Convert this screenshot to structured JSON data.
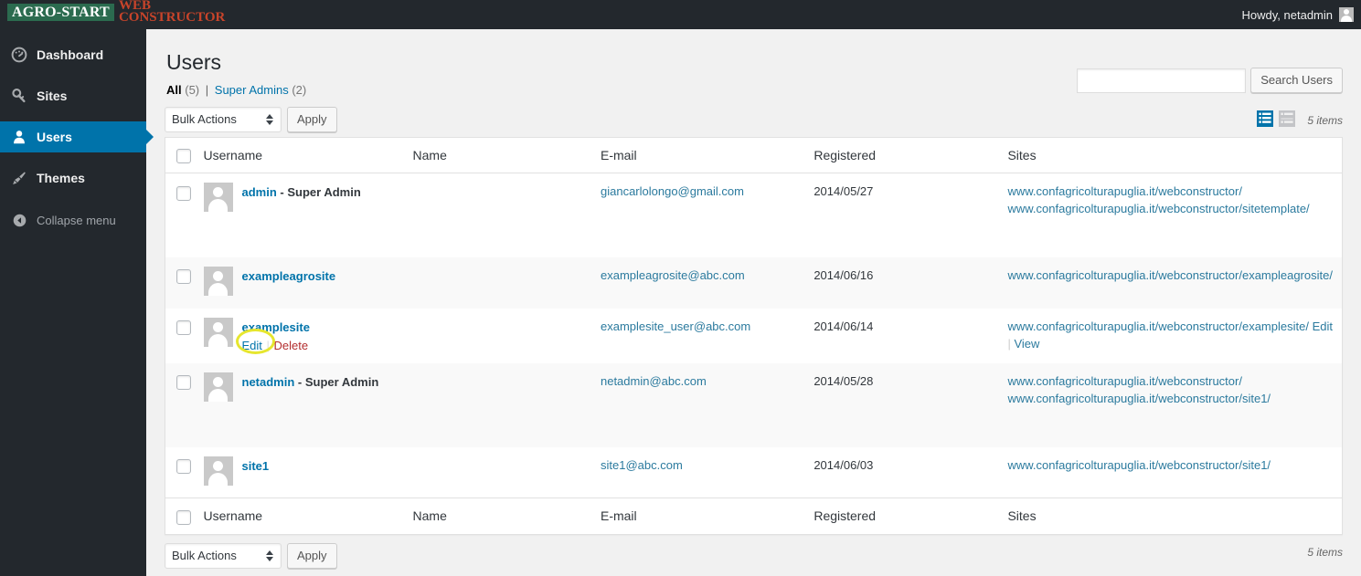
{
  "adminbar": {
    "brand_badge": "AGRO-START",
    "brand_word_1": "WEB",
    "brand_word_2": "CONSTRUCTOR",
    "howdy": "Howdy, netadmin",
    "avatar_icon": "user-avatar-icon"
  },
  "sidebar": {
    "items": [
      {
        "label": "Dashboard",
        "icon": "dashboard-icon",
        "current": false
      },
      {
        "label": "Sites",
        "icon": "key-icon",
        "current": false
      },
      {
        "label": "Users",
        "icon": "user-icon",
        "current": true
      },
      {
        "label": "Themes",
        "icon": "paintbrush-icon",
        "current": false
      }
    ],
    "collapse": {
      "label": "Collapse menu",
      "icon": "collapse-arrow-icon"
    }
  },
  "page": {
    "title": "Users",
    "views": [
      {
        "label": "All",
        "count": "(5)",
        "current": true
      },
      {
        "label": "Super Admins",
        "count": "(2)",
        "current": false
      }
    ],
    "view_separator": "|"
  },
  "search": {
    "value": "",
    "placeholder": "",
    "button_label": "Search Users"
  },
  "tablenav_top": {
    "bulk_label": "Bulk Actions",
    "apply_label": "Apply",
    "list_view_icon": "list-view-icon",
    "excerpt_view_icon": "excerpt-view-icon",
    "displaying_num": "5 items"
  },
  "tablenav_bottom": {
    "bulk_label": "Bulk Actions",
    "apply_label": "Apply",
    "displaying_num": "5 items"
  },
  "table": {
    "columns": [
      "Username",
      "Name",
      "E-mail",
      "Registered",
      "Sites"
    ],
    "rows": [
      {
        "username": "admin",
        "role_suffix": " - Super Admin",
        "name": "",
        "email": "giancarlolongo@gmail.com",
        "registered": "2014/05/27",
        "sites": [
          {
            "url": "www.confagricolturapuglia.it/webconstructor/",
            "actions": []
          },
          {
            "url": "www.confagricolturapuglia.it/webconstructor/sitetemplate/",
            "actions": []
          }
        ],
        "row_actions": [],
        "alt": false
      },
      {
        "username": "exampleagrosite",
        "role_suffix": "",
        "name": "",
        "email": "exampleagrosite@abc.com",
        "registered": "2014/06/16",
        "sites": [
          {
            "url": "www.confagricolturapuglia.it/webconstructor/exampleagrosite/",
            "actions": []
          }
        ],
        "row_actions": [],
        "alt": true
      },
      {
        "username": "examplesite",
        "role_suffix": "",
        "name": "",
        "email": "examplesite_user@abc.com",
        "registered": "2014/06/14",
        "sites": [
          {
            "url": "www.confagricolturapuglia.it/webconstructor/examplesite/",
            "actions": [
              "Edit",
              "View"
            ]
          }
        ],
        "row_actions": [
          "Edit",
          "Delete"
        ],
        "alt": false
      },
      {
        "username": "netadmin",
        "role_suffix": " - Super Admin",
        "name": "",
        "email": "netadmin@abc.com",
        "registered": "2014/05/28",
        "sites": [
          {
            "url": "www.confagricolturapuglia.it/webconstructor/",
            "actions": []
          },
          {
            "url": "www.confagricolturapuglia.it/webconstructor/site1/",
            "actions": []
          }
        ],
        "row_actions": [],
        "alt": true
      },
      {
        "username": "site1",
        "role_suffix": "",
        "name": "",
        "email": "site1@abc.com",
        "registered": "2014/06/03",
        "sites": [
          {
            "url": "www.confagricolturapuglia.it/webconstructor/site1/",
            "actions": []
          }
        ],
        "row_actions": [],
        "alt": false
      }
    ]
  },
  "annotation": {
    "shape": "ellipse",
    "target": "Edit",
    "color": "#e6e62e"
  },
  "colors": {
    "adminbar_bg": "#23282d",
    "sidebar_bg": "#23282d",
    "accent_blue": "#0073aa",
    "link_blue": "#2b7a9e",
    "delete_red": "#b32d2e",
    "brand_green": "#2b6b4f",
    "brand_orange": "#c8442a",
    "page_bg": "#f1f1f1",
    "annotation_yellow": "#e6e62e"
  }
}
